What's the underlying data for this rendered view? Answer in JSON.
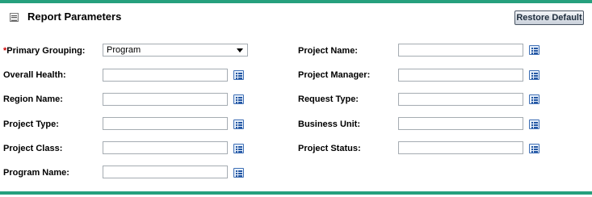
{
  "section": {
    "title": "Report Parameters",
    "restore_label": "Restore Default"
  },
  "fields": {
    "primary_grouping": {
      "required_mark": "*",
      "label": "Primary Grouping:",
      "value": "Program"
    },
    "overall_health": {
      "label": "Overall Health:",
      "value": ""
    },
    "region_name": {
      "label": "Region Name:",
      "value": ""
    },
    "project_type": {
      "label": "Project Type:",
      "value": ""
    },
    "project_class": {
      "label": "Project Class:",
      "value": ""
    },
    "program_name": {
      "label": "Program Name:",
      "value": ""
    },
    "project_name": {
      "label": "Project Name:",
      "value": ""
    },
    "project_manager": {
      "label": "Project Manager:",
      "value": ""
    },
    "request_type": {
      "label": "Request Type:",
      "value": ""
    },
    "business_unit": {
      "label": "Business Unit:",
      "value": ""
    },
    "project_status": {
      "label": "Project Status:",
      "value": ""
    }
  },
  "colors": {
    "accent_rule": "#26a07d",
    "required": "#cc0000",
    "lookup_icon": "#2457a3"
  }
}
